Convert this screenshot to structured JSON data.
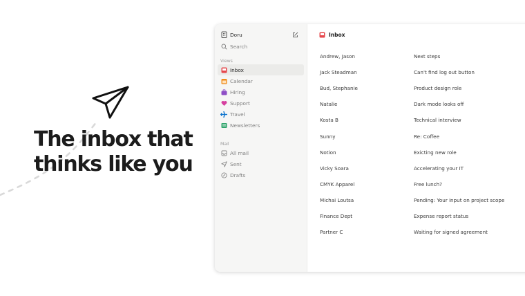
{
  "hero": {
    "headline_line1": "The inbox that",
    "headline_line2": "thinks like you"
  },
  "sidebar": {
    "account": "Doru",
    "search": "Search",
    "views_label": "Views",
    "views": [
      {
        "label": "Inbox",
        "icon": "inbox-icon",
        "color": "#e5484d",
        "active": true
      },
      {
        "label": "Calendar",
        "icon": "calendar-icon",
        "color": "#f08c1a"
      },
      {
        "label": "Hiring",
        "icon": "briefcase-icon",
        "color": "#8e4ec6"
      },
      {
        "label": "Support",
        "icon": "heart-icon",
        "color": "#d6409f"
      },
      {
        "label": "Travel",
        "icon": "airplane-icon",
        "color": "#0d74ce"
      },
      {
        "label": "Newsletters",
        "icon": "newspaper-icon",
        "color": "#30a46c"
      }
    ],
    "mail_label": "Mail",
    "mail": [
      {
        "label": "All mail",
        "icon": "tray-icon"
      },
      {
        "label": "Sent",
        "icon": "send-icon"
      },
      {
        "label": "Drafts",
        "icon": "draft-icon"
      }
    ]
  },
  "main": {
    "title": "Inbox",
    "messages": [
      {
        "sender": "Andrew, Jason",
        "subject": "Next steps"
      },
      {
        "sender": "Jack Steadman",
        "subject": "Can't find log out button"
      },
      {
        "sender": "Bud, Stephanie",
        "subject": "Product design role"
      },
      {
        "sender": "Natalie",
        "subject": "Dark mode looks off"
      },
      {
        "sender": "Kosta B",
        "subject": "Technical interview"
      },
      {
        "sender": "Sunny",
        "subject": "Re: Coffee"
      },
      {
        "sender": "Notion",
        "subject": "Exicting new role"
      },
      {
        "sender": "Vicky Soara",
        "subject": "Accelerating your IT"
      },
      {
        "sender": "CMYK Apparel",
        "subject": "Free lunch?"
      },
      {
        "sender": "Michai Loutsa",
        "subject": "Pending: Your input on project scope"
      },
      {
        "sender": "Finance Dept",
        "subject": "Expense report status"
      },
      {
        "sender": "Partner C",
        "subject": "Waiting for signed agreement"
      }
    ]
  }
}
